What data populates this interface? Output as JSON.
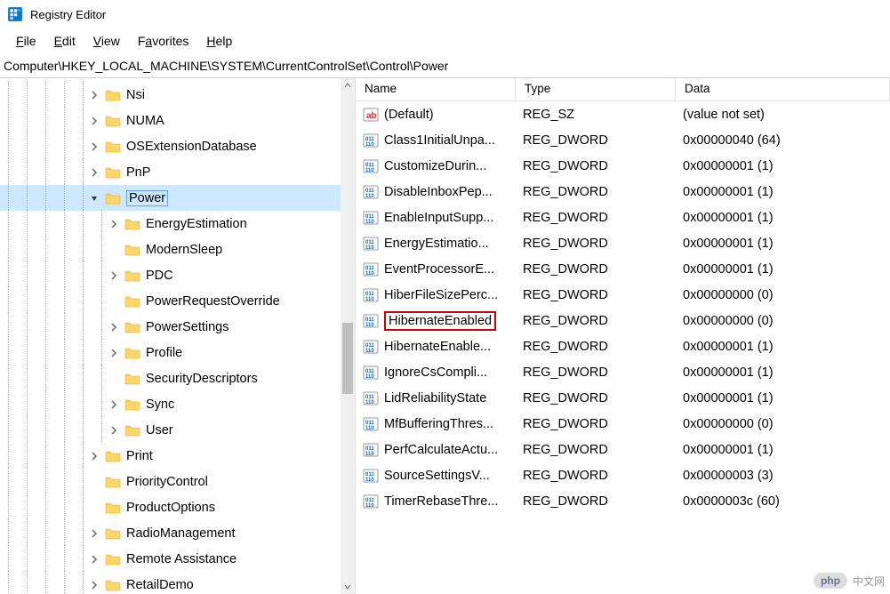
{
  "title": "Registry Editor",
  "menu": {
    "file": "File",
    "edit": "Edit",
    "view": "View",
    "favorites": "Favorites",
    "help": "Help"
  },
  "address": "Computer\\HKEY_LOCAL_MACHINE\\SYSTEM\\CurrentControlSet\\Control\\Power",
  "tree": [
    {
      "indent": 4,
      "toggle": "closed",
      "label": "Nsi"
    },
    {
      "indent": 4,
      "toggle": "closed",
      "label": "NUMA"
    },
    {
      "indent": 4,
      "toggle": "closed",
      "label": "OSExtensionDatabase"
    },
    {
      "indent": 4,
      "toggle": "closed",
      "label": "PnP"
    },
    {
      "indent": 4,
      "toggle": "open",
      "label": "Power",
      "selected": true
    },
    {
      "indent": 5,
      "toggle": "closed",
      "label": "EnergyEstimation"
    },
    {
      "indent": 5,
      "toggle": "none",
      "label": "ModernSleep"
    },
    {
      "indent": 5,
      "toggle": "closed",
      "label": "PDC"
    },
    {
      "indent": 5,
      "toggle": "none",
      "label": "PowerRequestOverride"
    },
    {
      "indent": 5,
      "toggle": "closed",
      "label": "PowerSettings"
    },
    {
      "indent": 5,
      "toggle": "closed",
      "label": "Profile"
    },
    {
      "indent": 5,
      "toggle": "none",
      "label": "SecurityDescriptors"
    },
    {
      "indent": 5,
      "toggle": "closed",
      "label": "Sync"
    },
    {
      "indent": 5,
      "toggle": "closed",
      "label": "User"
    },
    {
      "indent": 4,
      "toggle": "closed",
      "label": "Print"
    },
    {
      "indent": 4,
      "toggle": "none",
      "label": "PriorityControl"
    },
    {
      "indent": 4,
      "toggle": "none",
      "label": "ProductOptions"
    },
    {
      "indent": 4,
      "toggle": "closed",
      "label": "RadioManagement"
    },
    {
      "indent": 4,
      "toggle": "closed",
      "label": "Remote Assistance"
    },
    {
      "indent": 4,
      "toggle": "closed",
      "label": "RetailDemo"
    }
  ],
  "columns": {
    "name": "Name",
    "type": "Type",
    "data": "Data"
  },
  "values": [
    {
      "icon": "string",
      "name": "(Default)",
      "type": "REG_SZ",
      "data": "(value not set)"
    },
    {
      "icon": "dword",
      "name": "Class1InitialUnpa...",
      "type": "REG_DWORD",
      "data": "0x00000040 (64)"
    },
    {
      "icon": "dword",
      "name": "CustomizeDurin...",
      "type": "REG_DWORD",
      "data": "0x00000001 (1)"
    },
    {
      "icon": "dword",
      "name": "DisableInboxPep...",
      "type": "REG_DWORD",
      "data": "0x00000001 (1)"
    },
    {
      "icon": "dword",
      "name": "EnableInputSupp...",
      "type": "REG_DWORD",
      "data": "0x00000001 (1)"
    },
    {
      "icon": "dword",
      "name": "EnergyEstimatio...",
      "type": "REG_DWORD",
      "data": "0x00000001 (1)"
    },
    {
      "icon": "dword",
      "name": "EventProcessorE...",
      "type": "REG_DWORD",
      "data": "0x00000001 (1)"
    },
    {
      "icon": "dword",
      "name": "HiberFileSizePerc...",
      "type": "REG_DWORD",
      "data": "0x00000000 (0)"
    },
    {
      "icon": "dword",
      "name": "HibernateEnabled",
      "type": "REG_DWORD",
      "data": "0x00000000 (0)",
      "highlighted": true
    },
    {
      "icon": "dword",
      "name": "HibernateEnable...",
      "type": "REG_DWORD",
      "data": "0x00000001 (1)"
    },
    {
      "icon": "dword",
      "name": "IgnoreCsCompli...",
      "type": "REG_DWORD",
      "data": "0x00000001 (1)"
    },
    {
      "icon": "dword",
      "name": "LidReliabilityState",
      "type": "REG_DWORD",
      "data": "0x00000001 (1)"
    },
    {
      "icon": "dword",
      "name": "MfBufferingThres...",
      "type": "REG_DWORD",
      "data": "0x00000000 (0)"
    },
    {
      "icon": "dword",
      "name": "PerfCalculateActu...",
      "type": "REG_DWORD",
      "data": "0x00000001 (1)"
    },
    {
      "icon": "dword",
      "name": "SourceSettingsV...",
      "type": "REG_DWORD",
      "data": "0x00000003 (3)"
    },
    {
      "icon": "dword",
      "name": "TimerRebaseThre...",
      "type": "REG_DWORD",
      "data": "0x0000003c (60)"
    }
  ],
  "watermark": {
    "logo": "php",
    "text": "中文网"
  }
}
